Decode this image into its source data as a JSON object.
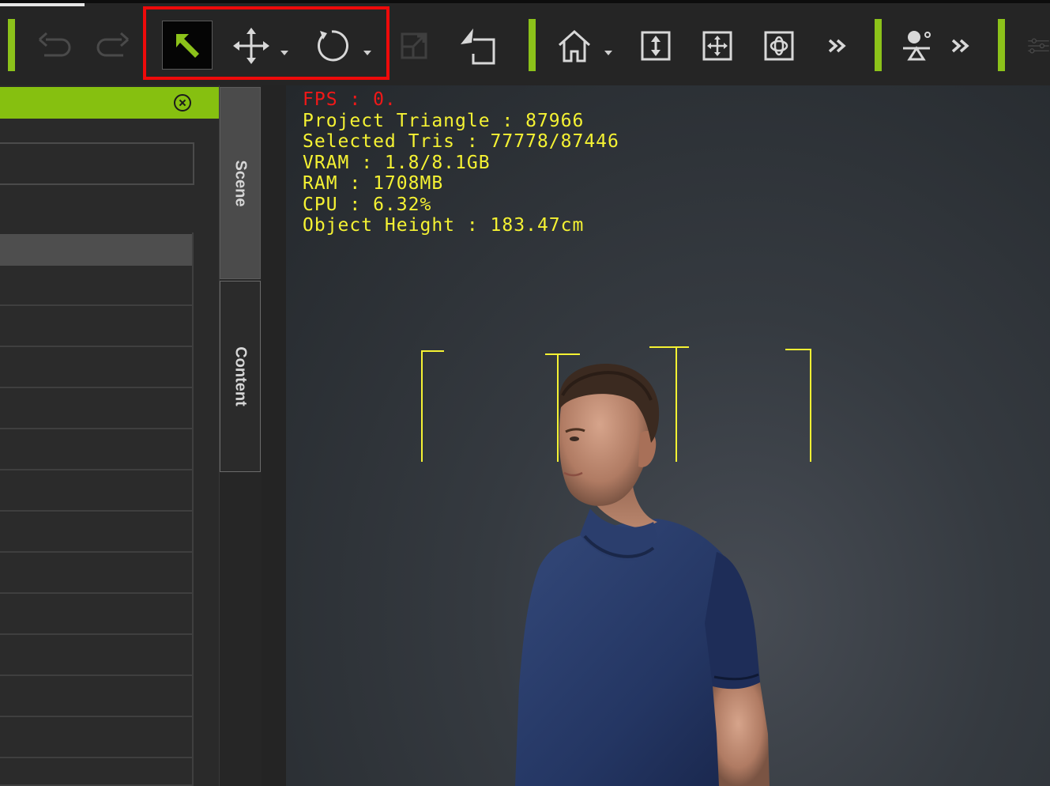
{
  "toolbar": {
    "tools": [
      {
        "name": "undo",
        "icon": "undo-icon",
        "enabled": false
      },
      {
        "name": "redo",
        "icon": "redo-icon",
        "enabled": false
      },
      {
        "name": "select",
        "icon": "select-arrow-icon",
        "active": true
      },
      {
        "name": "move",
        "icon": "move-icon",
        "has_dropdown": true
      },
      {
        "name": "rotate",
        "icon": "rotate-icon",
        "has_dropdown": true
      },
      {
        "name": "scale",
        "icon": "scale-icon",
        "enabled": false
      },
      {
        "name": "export",
        "icon": "export-icon"
      },
      {
        "name": "home-camera",
        "icon": "home-icon",
        "has_dropdown": true
      },
      {
        "name": "fit-vertical",
        "icon": "fit-vertical-icon"
      },
      {
        "name": "pan",
        "icon": "pan-icon"
      },
      {
        "name": "orbit",
        "icon": "orbit-icon"
      },
      {
        "name": "more",
        "icon": "double-chevron-icon"
      },
      {
        "name": "light",
        "icon": "light-icon"
      },
      {
        "name": "more2",
        "icon": "double-chevron-icon"
      },
      {
        "name": "settings",
        "icon": "sliders-icon"
      }
    ],
    "accent_color": "#8cc21a",
    "highlight_color": "#ee0a0a"
  },
  "left_panel": {
    "header_color": "#86c010",
    "rows": 12
  },
  "side_tabs": {
    "scene": "Scene",
    "content": "Content"
  },
  "viewport": {
    "stats": {
      "fps": "FPS : 0.",
      "project_triangle": "Project Triangle : 87966",
      "selected_tris": "Selected Tris : 77778/87446",
      "vram": "VRAM : 1.8/8.1GB",
      "ram": "RAM : 1708MB",
      "cpu": "CPU : 6.32%",
      "object_height": "Object Height : 183.47cm"
    },
    "stats_color": "#f5f233",
    "fps_color": "#f01818"
  }
}
